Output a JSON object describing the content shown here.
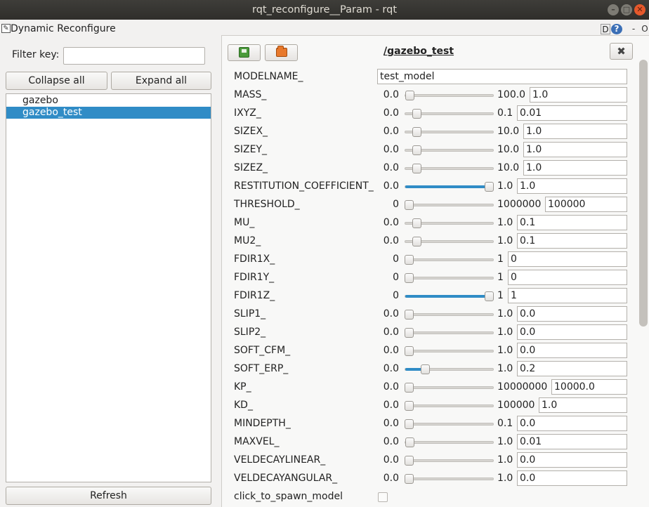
{
  "window": {
    "title": "rqt_reconfigure__Param - rqt",
    "controls": [
      "–",
      "□",
      "✕"
    ]
  },
  "plugin": {
    "title": "Dynamic Reconfigure",
    "header_buttons": {
      "d": "D",
      "help": "?",
      "dash": "-",
      "o": "O"
    }
  },
  "left": {
    "filter_label": "Filter key:",
    "filter_value": "",
    "collapse_label": "Collapse all",
    "expand_label": "Expand all",
    "nodes": [
      {
        "label": "gazebo",
        "selected": false
      },
      {
        "label": "gazebo_test",
        "selected": true
      }
    ],
    "refresh_label": "Refresh"
  },
  "right": {
    "node_title": "/gazebo_test",
    "close_glyph": "✖",
    "params": [
      {
        "name": "MODELNAME_",
        "type": "string",
        "value": "test_model"
      },
      {
        "name": "MASS_",
        "type": "number",
        "min": "0.0",
        "max": "100.0",
        "value": "1.0",
        "position": 0.01,
        "fill": false
      },
      {
        "name": "IXYZ_",
        "type": "number",
        "min": "0.0",
        "max": "0.1",
        "value": "0.01",
        "position": 0.1,
        "fill": false
      },
      {
        "name": "SIZEX_",
        "type": "number",
        "min": "0.0",
        "max": "10.0",
        "value": "1.0",
        "position": 0.1,
        "fill": false
      },
      {
        "name": "SIZEY_",
        "type": "number",
        "min": "0.0",
        "max": "10.0",
        "value": "1.0",
        "position": 0.1,
        "fill": false
      },
      {
        "name": "SIZEZ_",
        "type": "number",
        "min": "0.0",
        "max": "10.0",
        "value": "1.0",
        "position": 0.1,
        "fill": false
      },
      {
        "name": "RESTITUTION_COEFFICIENT_",
        "type": "number",
        "min": "0.0",
        "max": "1.0",
        "value": "1.0",
        "position": 1.0,
        "fill": true
      },
      {
        "name": "THRESHOLD_",
        "type": "number",
        "min": "0",
        "max": "1000000",
        "value": "100000",
        "position": 0.0,
        "fill": false
      },
      {
        "name": "MU_",
        "type": "number",
        "min": "0.0",
        "max": "1.0",
        "value": "0.1",
        "position": 0.1,
        "fill": false
      },
      {
        "name": "MU2_",
        "type": "number",
        "min": "0.0",
        "max": "1.0",
        "value": "0.1",
        "position": 0.1,
        "fill": false
      },
      {
        "name": "FDIR1X_",
        "type": "number",
        "min": "0",
        "max": "1",
        "value": "0",
        "position": 0.0,
        "fill": false
      },
      {
        "name": "FDIR1Y_",
        "type": "number",
        "min": "0",
        "max": "1",
        "value": "0",
        "position": 0.0,
        "fill": false
      },
      {
        "name": "FDIR1Z_",
        "type": "number",
        "min": "0",
        "max": "1",
        "value": "1",
        "position": 1.0,
        "fill": true
      },
      {
        "name": "SLIP1_",
        "type": "number",
        "min": "0.0",
        "max": "1.0",
        "value": "0.0",
        "position": 0.0,
        "fill": false
      },
      {
        "name": "SLIP2_",
        "type": "number",
        "min": "0.0",
        "max": "1.0",
        "value": "0.0",
        "position": 0.0,
        "fill": false
      },
      {
        "name": "SOFT_CFM_",
        "type": "number",
        "min": "0.0",
        "max": "1.0",
        "value": "0.0",
        "position": 0.0,
        "fill": false
      },
      {
        "name": "SOFT_ERP_",
        "type": "number",
        "min": "0.0",
        "max": "1.0",
        "value": "0.2",
        "position": 0.2,
        "fill": true
      },
      {
        "name": "KP_",
        "type": "number",
        "min": "0.0",
        "max": "10000000",
        "value": "10000.0",
        "position": 0.0,
        "fill": false
      },
      {
        "name": "KD_",
        "type": "number",
        "min": "0.0",
        "max": "100000",
        "value": "1.0",
        "position": 0.0,
        "fill": false
      },
      {
        "name": "MINDEPTH_",
        "type": "number",
        "min": "0.0",
        "max": "0.1",
        "value": "0.0",
        "position": 0.0,
        "fill": false
      },
      {
        "name": "MAXVEL_",
        "type": "number",
        "min": "0.0",
        "max": "1.0",
        "value": "0.01",
        "position": 0.01,
        "fill": false
      },
      {
        "name": "VELDECAYLINEAR_",
        "type": "number",
        "min": "0.0",
        "max": "1.0",
        "value": "0.0",
        "position": 0.0,
        "fill": false
      },
      {
        "name": "VELDECAYANGULAR_",
        "type": "number",
        "min": "0.0",
        "max": "1.0",
        "value": "0.0",
        "position": 0.0,
        "fill": false
      },
      {
        "name": "click_to_spawn_model",
        "type": "bool",
        "value": false
      }
    ]
  },
  "colors": {
    "accent": "#308cc6",
    "titlebar": "#2f2e2b",
    "close": "#e5582b"
  }
}
